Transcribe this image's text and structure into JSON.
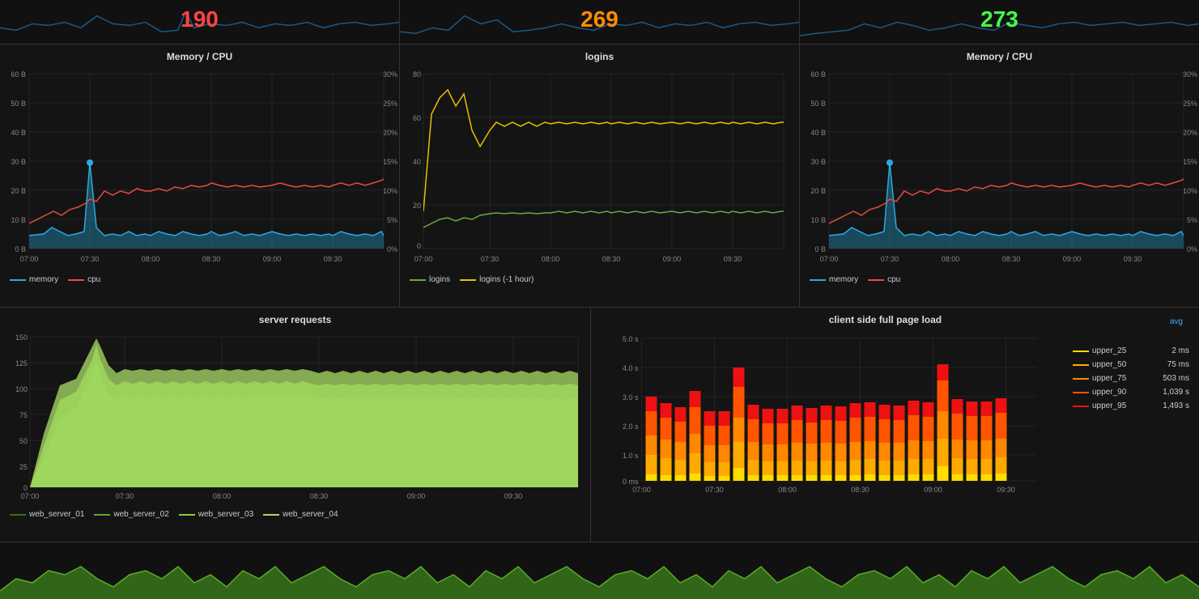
{
  "top": {
    "panels": [
      {
        "value": "190",
        "color": "#ff4444"
      },
      {
        "value": "269",
        "color": "#ff8c00"
      },
      {
        "value": "273",
        "color": "#44ff44"
      }
    ]
  },
  "memory_cpu_1": {
    "title": "Memory / CPU",
    "y_left": [
      "60 B",
      "50 B",
      "40 B",
      "30 B",
      "20 B",
      "10 B",
      "0 B"
    ],
    "y_right": [
      "30%",
      "25%",
      "20%",
      "15%",
      "10%",
      "5%",
      "0%"
    ],
    "x_labels": [
      "07:00",
      "07:30",
      "08:00",
      "08:30",
      "09:00",
      "09:30"
    ],
    "legend": [
      {
        "label": "memory",
        "color": "#29abe2",
        "type": "line"
      },
      {
        "label": "cpu",
        "color": "#e74c3c",
        "type": "line"
      }
    ]
  },
  "logins": {
    "title": "logins",
    "y_labels": [
      "80",
      "60",
      "40",
      "20",
      "0"
    ],
    "x_labels": [
      "07:00",
      "07:30",
      "08:00",
      "08:30",
      "09:00",
      "09:30"
    ],
    "legend": [
      {
        "label": "logins",
        "color": "#6aaa44",
        "type": "line"
      },
      {
        "label": "logins (-1 hour)",
        "color": "#e8c000",
        "type": "line"
      }
    ]
  },
  "memory_cpu_2": {
    "title": "Memory / CPU",
    "y_left": [
      "60 B",
      "50 B",
      "40 B",
      "30 B",
      "20 B",
      "10 B",
      "0 B"
    ],
    "y_right": [
      "30%",
      "25%",
      "20%",
      "15%",
      "10%",
      "5%",
      "0%"
    ],
    "x_labels": [
      "07:00",
      "07:30",
      "08:00",
      "08:30",
      "09:00",
      "09:30"
    ],
    "legend": [
      {
        "label": "memory",
        "color": "#29abe2",
        "type": "line"
      },
      {
        "label": "cpu",
        "color": "#e74c3c",
        "type": "line"
      }
    ]
  },
  "server_requests": {
    "title": "server requests",
    "y_labels": [
      "150",
      "125",
      "100",
      "75",
      "50",
      "25",
      "0"
    ],
    "x_labels": [
      "07:00",
      "07:30",
      "08:00",
      "08:30",
      "09:00",
      "09:30"
    ],
    "legend": [
      {
        "label": "web_server_01",
        "color": "#3a6e1a"
      },
      {
        "label": "web_server_02",
        "color": "#5aad28"
      },
      {
        "label": "web_server_03",
        "color": "#88cc44"
      },
      {
        "label": "web_server_04",
        "color": "#aade66"
      }
    ]
  },
  "page_load": {
    "title": "client side full page load",
    "avg_label": "avg",
    "y_labels": [
      "5.0 s",
      "4.0 s",
      "3.0 s",
      "2.0 s",
      "1.0 s",
      "0 ms"
    ],
    "x_labels": [
      "07:00",
      "07:30",
      "08:00",
      "08:30",
      "09:00",
      "09:30"
    ],
    "legend": [
      {
        "label": "upper_25",
        "color": "#ffdd00",
        "value": "2 ms"
      },
      {
        "label": "upper_50",
        "color": "#ffaa00",
        "value": "75 ms"
      },
      {
        "label": "upper_75",
        "color": "#ff8800",
        "value": "503 ms"
      },
      {
        "label": "upper_90",
        "color": "#ff5500",
        "value": "1,039 s"
      },
      {
        "label": "upper_95",
        "color": "#ee1111",
        "value": "1,493 s"
      }
    ]
  }
}
